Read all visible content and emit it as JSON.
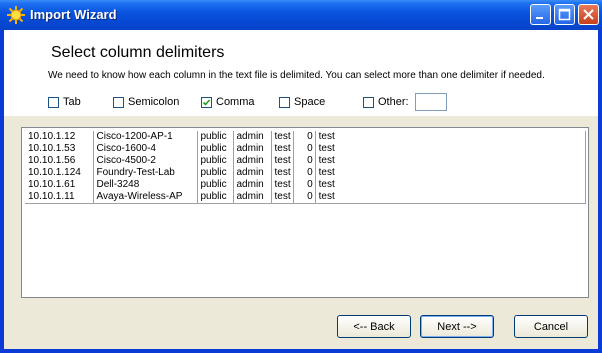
{
  "window": {
    "title": "Import Wizard"
  },
  "header": {
    "title": "Select column delimiters",
    "description": "We need to know how each column in the text file is delimited. You can select more than one delimiter if needed."
  },
  "delimiters": {
    "tab": {
      "label": "Tab",
      "checked": false
    },
    "semicolon": {
      "label": "Semicolon",
      "checked": false
    },
    "comma": {
      "label": "Comma",
      "checked": true
    },
    "space": {
      "label": "Space",
      "checked": false
    },
    "other": {
      "label": "Other:",
      "checked": false,
      "value": ""
    }
  },
  "preview": {
    "rows": [
      [
        "10.10.1.12",
        "Cisco-1200-AP-1",
        "public",
        "admin",
        "test",
        "0",
        "test"
      ],
      [
        "10.10.1.53",
        "Cisco-1600-4",
        "public",
        "admin",
        "test",
        "0",
        "test"
      ],
      [
        "10.10.1.56",
        "Cisco-4500-2",
        "public",
        "admin",
        "test",
        "0",
        "test"
      ],
      [
        "10.10.1.124",
        "Foundry-Test-Lab",
        "public",
        "admin",
        "test",
        "0",
        "test"
      ],
      [
        "10.10.1.61",
        "Dell-3248",
        "public",
        "admin",
        "test",
        "0",
        "test"
      ],
      [
        "10.10.1.11",
        "Avaya-Wireless-AP",
        "public",
        "admin",
        "test",
        "0",
        "test"
      ]
    ]
  },
  "buttons": {
    "back": "<-- Back",
    "next": "Next -->",
    "cancel": "Cancel"
  },
  "colors": {
    "titlebar": "#0a55e0",
    "frame": "#0b3bd6",
    "dialog_bg": "#ece9d8"
  }
}
